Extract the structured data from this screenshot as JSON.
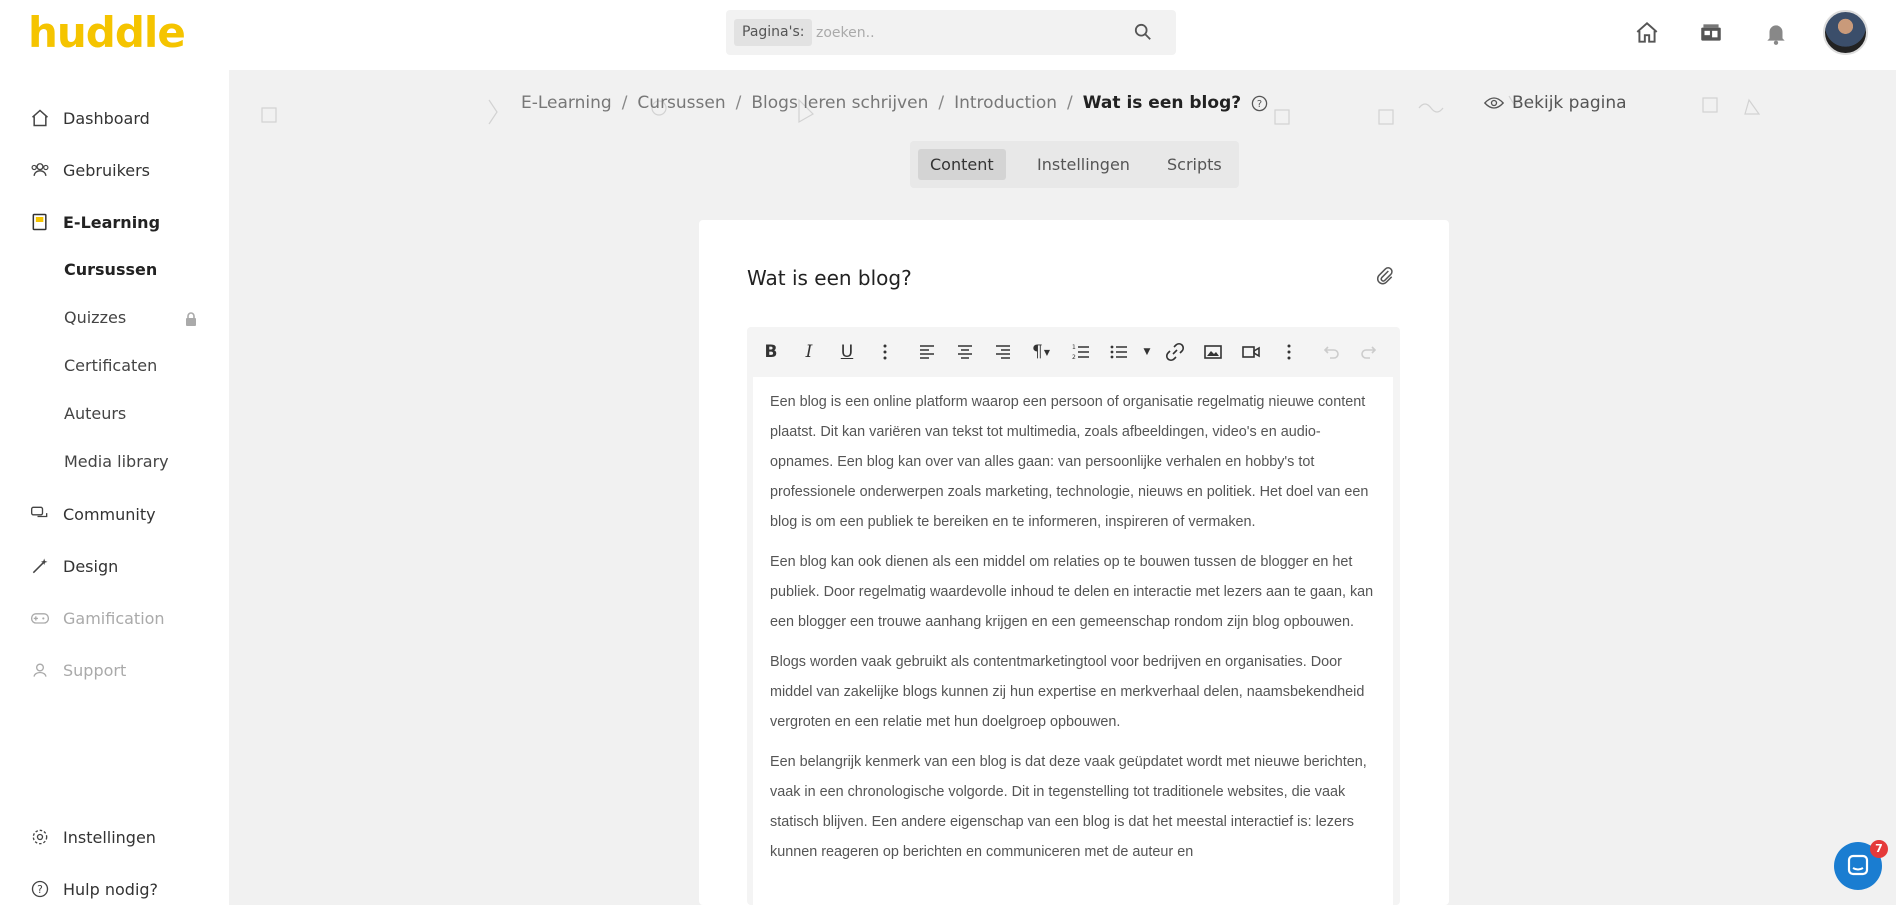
{
  "brand": {
    "logo_text": "huddle",
    "color": "#f5c400"
  },
  "search": {
    "scope_label": "Pagina's:",
    "placeholder": "zoeken.."
  },
  "header_icons": [
    "home-icon",
    "storefront-icon",
    "bell-icon"
  ],
  "sidebar": {
    "items": [
      {
        "label": "Dashboard",
        "icon": "home-icon",
        "state": "normal"
      },
      {
        "label": "Gebruikers",
        "icon": "users-icon",
        "state": "normal"
      },
      {
        "label": "E-Learning",
        "icon": "book-icon",
        "state": "active"
      },
      {
        "label": "Community",
        "icon": "chat-icon",
        "state": "normal"
      },
      {
        "label": "Design",
        "icon": "magic-wand-icon",
        "state": "normal"
      },
      {
        "label": "Gamification",
        "icon": "gamepad-icon",
        "state": "disabled"
      },
      {
        "label": "Support",
        "icon": "support-icon",
        "state": "disabled"
      }
    ],
    "sub_items": [
      {
        "label": "Cursussen",
        "active": true
      },
      {
        "label": "Quizzes",
        "locked": true
      },
      {
        "label": "Certificaten"
      },
      {
        "label": "Auteurs"
      },
      {
        "label": "Media library"
      }
    ],
    "bottom_items": [
      {
        "label": "Instellingen",
        "icon": "gear-icon"
      },
      {
        "label": "Hulp nodig?",
        "icon": "help-icon"
      }
    ]
  },
  "breadcrumb": {
    "items": [
      "E-Learning",
      "Cursussen",
      "Blogs leren schrijven",
      "Introduction"
    ],
    "current": "Wat is een blog?"
  },
  "view_page_label": "Bekijk pagina",
  "tabs": [
    {
      "label": "Content",
      "active": true
    },
    {
      "label": "Instellingen"
    },
    {
      "label": "Scripts"
    }
  ],
  "page": {
    "title": "Wat is een blog?",
    "paragraphs": [
      "Een blog is een online platform waarop een persoon of organisatie regelmatig nieuwe content plaatst. Dit kan variëren van tekst tot multimedia, zoals afbeeldingen, video's en audio-opnames. Een blog kan over van alles gaan: van persoonlijke verhalen en hobby's tot professionele onderwerpen zoals marketing, technologie, nieuws en politiek. Het doel van een blog is om een publiek te bereiken en te informeren, inspireren of vermaken.",
      "Een blog kan ook dienen als een middel om relaties op te bouwen tussen de blogger en het publiek. Door regelmatig waardevolle inhoud te delen en interactie met lezers aan te gaan, kan een blogger een trouwe aanhang krijgen en een gemeenschap rondom zijn blog opbouwen.",
      "Blogs worden vaak gebruikt als contentmarketingtool voor bedrijven en organisaties. Door middel van zakelijke blogs kunnen zij hun expertise en merkverhaal delen, naamsbekendheid vergroten en een relatie met hun doelgroep opbouwen.",
      "Een belangrijk kenmerk van een blog is dat deze vaak geüpdatet wordt met nieuwe berichten, vaak in een chronologische volgorde. Dit in tegenstelling tot traditionele websites, die vaak statisch blijven. Een andere eigenschap van een blog is dat het meestal interactief is: lezers kunnen reageren op berichten en communiceren met de auteur en"
    ]
  },
  "chat": {
    "badge_count": "7"
  }
}
